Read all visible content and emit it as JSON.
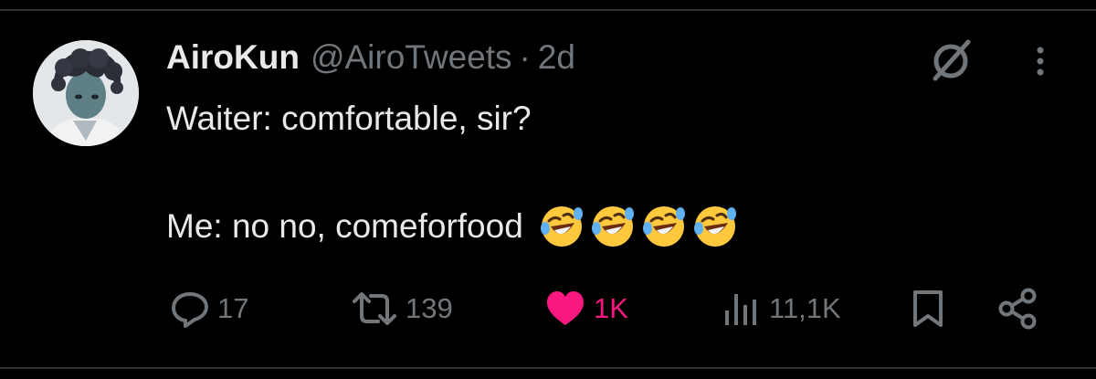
{
  "tweet": {
    "author": {
      "display_name": "AiroKun",
      "handle": "@AiroTweets"
    },
    "separator": "·",
    "time": "2d",
    "text_line1": "Waiter: comfortable, sir?",
    "text_line2": "Me: no no, comeforfood",
    "emojis": [
      "rolling-on-floor-laughing",
      "rolling-on-floor-laughing",
      "rolling-on-floor-laughing",
      "rolling-on-floor-laughing"
    ]
  },
  "actions": {
    "replies": "17",
    "retweets": "139",
    "likes": "1K",
    "views": "11,1K"
  },
  "icons": {
    "grok": "grok-icon",
    "more": "more-icon",
    "reply": "reply-icon",
    "retweet": "retweet-icon",
    "like": "heart-icon",
    "views": "views-icon",
    "bookmark": "bookmark-icon",
    "share": "share-icon"
  },
  "colors": {
    "background": "#000000",
    "text": "#e7e9ea",
    "muted": "#71767b",
    "like": "#f91880",
    "divider": "#2f3336"
  }
}
